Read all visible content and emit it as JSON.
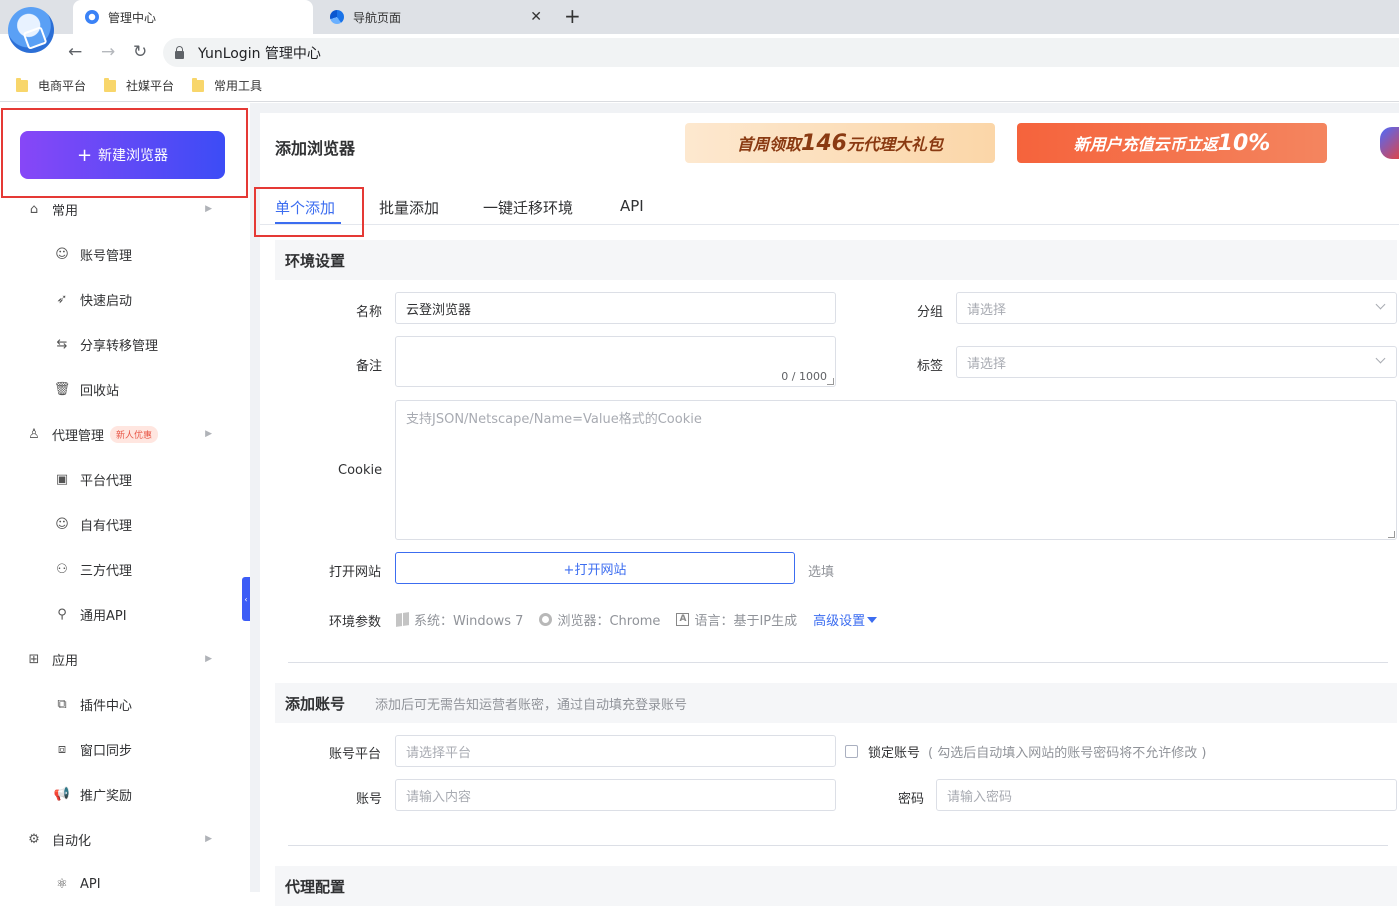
{
  "browser": {
    "tabs": [
      {
        "title": "管理中心",
        "active": true
      },
      {
        "title": "导航页面",
        "active": false
      }
    ],
    "address": "YunLogin 管理中心",
    "bookmarks": [
      "电商平台",
      "社媒平台",
      "常用工具"
    ]
  },
  "sidebar": {
    "new_browser_label": "新建浏览器",
    "groups": {
      "common": "常用",
      "common_items": [
        "账号管理",
        "快速启动",
        "分享转移管理",
        "回收站"
      ],
      "proxy": "代理管理",
      "proxy_badge": "新人优惠",
      "proxy_items": [
        "平台代理",
        "自有代理",
        "三方代理",
        "通用API"
      ],
      "apps": "应用",
      "apps_items": [
        "插件中心",
        "窗口同步",
        "推广奖励"
      ],
      "automation": "自动化",
      "automation_items": [
        "API"
      ]
    }
  },
  "main": {
    "title": "添加浏览器",
    "banners": {
      "b1_pre": "首周领取",
      "b1_num": "146",
      "b1_post": "元代理大礼包",
      "b2_pre": "新用户充值云币立返",
      "b2_num": "10%"
    },
    "tabs": [
      "单个添加",
      "批量添加",
      "一键迁移环境",
      "API"
    ],
    "env_section": {
      "title": "环境设置",
      "name_label": "名称",
      "name_value": "云登浏览器",
      "group_label": "分组",
      "group_placeholder": "请选择",
      "remark_label": "备注",
      "remark_counter": "0 / 1000",
      "tag_label": "标签",
      "tag_placeholder": "请选择",
      "cookie_label": "Cookie",
      "cookie_placeholder": "支持JSON/Netscape/Name=Value格式的Cookie",
      "open_site_label": "打开网站",
      "open_site_button": "+打开网站",
      "optional": "选填",
      "params_label": "环境参数",
      "system": "系统：Windows 7",
      "browser": "浏览器：Chrome",
      "language": "语言：基于IP生成",
      "advanced": "高级设置"
    },
    "account_section": {
      "title": "添加账号",
      "hint": "添加后可无需告知运营者账密，通过自动填充登录账号",
      "platform_label": "账号平台",
      "platform_placeholder": "请选择平台",
      "lock_label": "锁定账号",
      "lock_note": "( 勾选后自动填入网站的账号密码将不允许修改 )",
      "account_label": "账号",
      "account_placeholder": "请输入内容",
      "password_label": "密码",
      "password_placeholder": "请输入密码"
    },
    "proxy_section": {
      "title": "代理配置"
    }
  }
}
